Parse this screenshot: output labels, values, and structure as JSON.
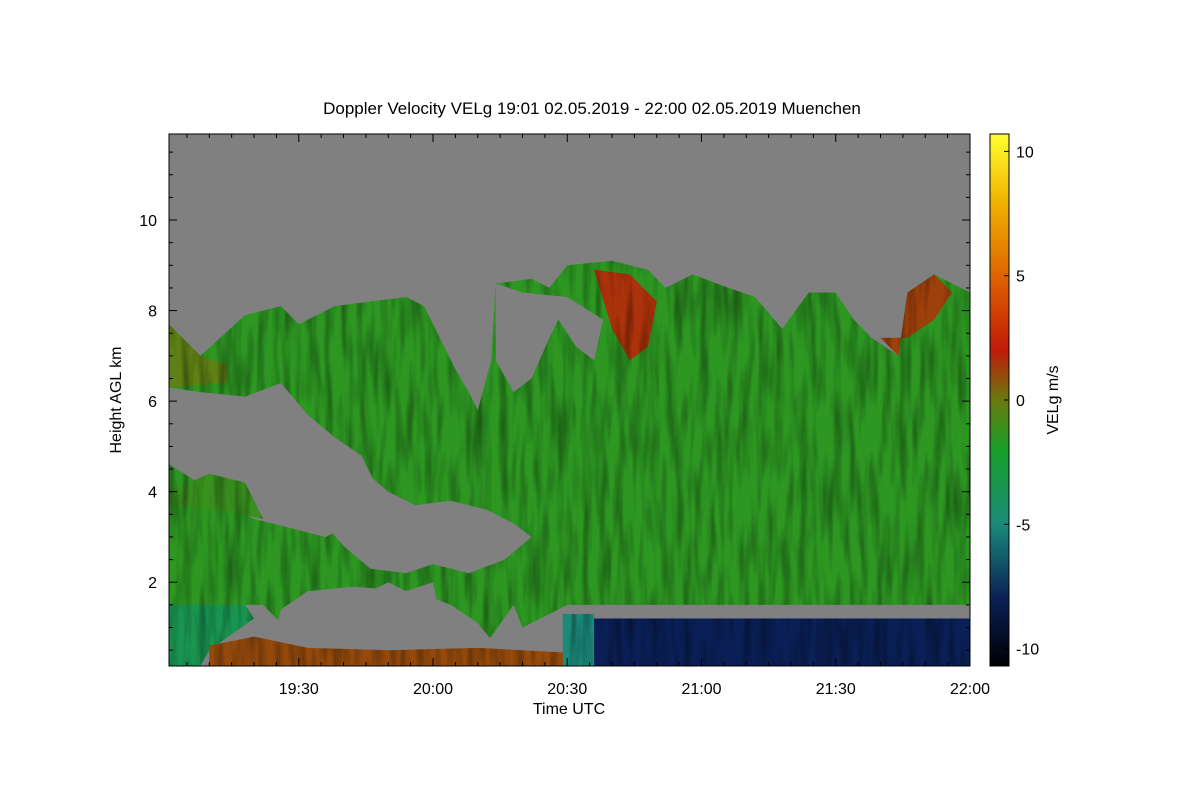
{
  "chart_data": {
    "type": "heatmap",
    "title": "Doppler Velocity VELg   19:01 02.05.2019 - 22:00 02.05.2019 Muenchen",
    "xlabel": "Time UTC",
    "ylabel": "Height AGL km",
    "colorbar_label": "VELg m/s",
    "x_range_minutes_utc": [
      1141,
      1320
    ],
    "x_ticks": [
      {
        "label": "19:30",
        "minutes": 1170
      },
      {
        "label": "20:00",
        "minutes": 1200
      },
      {
        "label": "20:30",
        "minutes": 1230
      },
      {
        "label": "21:00",
        "minutes": 1260
      },
      {
        "label": "21:30",
        "minutes": 1290
      },
      {
        "label": "22:00",
        "minutes": 1320
      }
    ],
    "ylim": [
      0.15,
      11.9
    ],
    "y_ticks": [
      2,
      4,
      6,
      8,
      10
    ],
    "colorbar": {
      "range": [
        -10.7,
        10.7
      ],
      "ticks": [
        10,
        5,
        0,
        -5,
        -10
      ],
      "stops": [
        {
          "value": -10.7,
          "color": "#000000"
        },
        {
          "value": -8.0,
          "color": "#0a1f55"
        },
        {
          "value": -5.0,
          "color": "#1a8a7a"
        },
        {
          "value": -2.0,
          "color": "#18a028"
        },
        {
          "value": 0.0,
          "color": "#6a7a10"
        },
        {
          "value": 2.0,
          "color": "#c01a08"
        },
        {
          "value": 5.0,
          "color": "#e06400"
        },
        {
          "value": 8.0,
          "color": "#f0b400"
        },
        {
          "value": 10.7,
          "color": "#ffff30"
        }
      ]
    },
    "no_signal_color": "#808080",
    "regions": [
      {
        "name": "main-cloud-green",
        "velocity": -1.5,
        "polygon": [
          [
            1141,
            7.7
          ],
          [
            1148,
            7.0
          ],
          [
            1158,
            7.9
          ],
          [
            1166,
            8.1
          ],
          [
            1170,
            7.7
          ],
          [
            1178,
            8.1
          ],
          [
            1186,
            8.2
          ],
          [
            1194,
            8.3
          ],
          [
            1198,
            8.1
          ],
          [
            1202,
            7.3
          ],
          [
            1205,
            6.7
          ],
          [
            1208,
            6.2
          ],
          [
            1210,
            5.8
          ],
          [
            1213,
            6.9
          ],
          [
            1214,
            8.6
          ],
          [
            1222,
            8.7
          ],
          [
            1226,
            8.5
          ],
          [
            1230,
            9.0
          ],
          [
            1240,
            9.1
          ],
          [
            1248,
            8.9
          ],
          [
            1252,
            8.5
          ],
          [
            1258,
            8.8
          ],
          [
            1266,
            8.5
          ],
          [
            1272,
            8.3
          ],
          [
            1278,
            7.6
          ],
          [
            1284,
            8.4
          ],
          [
            1290,
            8.4
          ],
          [
            1294,
            7.8
          ],
          [
            1298,
            7.4
          ],
          [
            1304,
            7.0
          ],
          [
            1306,
            8.4
          ],
          [
            1312,
            8.8
          ],
          [
            1320,
            8.4
          ],
          [
            1320,
            1.5
          ],
          [
            1230,
            1.5
          ],
          [
            1224,
            1.2
          ],
          [
            1220,
            1.0
          ],
          [
            1218,
            1.5
          ],
          [
            1213,
            0.8
          ],
          [
            1208,
            0.5
          ],
          [
            1202,
            1.0
          ],
          [
            1200,
            2.0
          ],
          [
            1194,
            1.8
          ],
          [
            1190,
            2.0
          ],
          [
            1184,
            1.7
          ],
          [
            1178,
            1.8
          ],
          [
            1172,
            1.2
          ],
          [
            1166,
            1.1
          ],
          [
            1162,
            1.5
          ],
          [
            1141,
            1.5
          ]
        ]
      },
      {
        "name": "gap-left-upper",
        "velocity": null,
        "polygon": [
          [
            1141,
            6.3
          ],
          [
            1148,
            6.2
          ],
          [
            1158,
            6.1
          ],
          [
            1166,
            6.4
          ],
          [
            1172,
            5.7
          ],
          [
            1178,
            5.2
          ],
          [
            1184,
            4.8
          ],
          [
            1188,
            4.0
          ],
          [
            1184,
            3.4
          ],
          [
            1176,
            3.0
          ],
          [
            1168,
            3.2
          ],
          [
            1160,
            3.4
          ],
          [
            1152,
            3.8
          ],
          [
            1146,
            4.3
          ],
          [
            1141,
            4.6
          ]
        ]
      },
      {
        "name": "gap-mid",
        "velocity": null,
        "polygon": [
          [
            1176,
            4.3
          ],
          [
            1184,
            4.5
          ],
          [
            1190,
            4.0
          ],
          [
            1196,
            3.7
          ],
          [
            1204,
            3.8
          ],
          [
            1212,
            3.6
          ],
          [
            1218,
            3.3
          ],
          [
            1222,
            3.0
          ],
          [
            1216,
            2.5
          ],
          [
            1208,
            2.2
          ],
          [
            1200,
            2.4
          ],
          [
            1194,
            2.2
          ],
          [
            1186,
            2.3
          ],
          [
            1180,
            2.8
          ],
          [
            1174,
            3.5
          ]
        ]
      },
      {
        "name": "gap-lower-left",
        "velocity": null,
        "polygon": [
          [
            1166,
            1.4
          ],
          [
            1172,
            1.8
          ],
          [
            1182,
            1.9
          ],
          [
            1196,
            1.8
          ],
          [
            1204,
            1.5
          ],
          [
            1210,
            1.1
          ],
          [
            1214,
            0.6
          ],
          [
            1220,
            0.4
          ],
          [
            1220,
            0.15
          ],
          [
            1168,
            0.15
          ],
          [
            1164,
            0.6
          ]
        ]
      },
      {
        "name": "gap-top-notch",
        "velocity": null,
        "polygon": [
          [
            1214,
            6.9
          ],
          [
            1218,
            6.2
          ],
          [
            1222,
            6.5
          ],
          [
            1226,
            7.4
          ],
          [
            1228,
            7.8
          ],
          [
            1232,
            7.2
          ],
          [
            1236,
            6.9
          ],
          [
            1238,
            7.8
          ],
          [
            1230,
            8.3
          ],
          [
            1220,
            8.4
          ],
          [
            1214,
            8.6
          ]
        ]
      },
      {
        "name": "boundary-layer-blue",
        "velocity": -8.0,
        "polygon": [
          [
            1234,
            1.2
          ],
          [
            1320,
            1.2
          ],
          [
            1320,
            0.15
          ],
          [
            1234,
            0.15
          ]
        ]
      },
      {
        "name": "boundary-layer-teal",
        "velocity": -5.0,
        "polygon": [
          [
            1229,
            1.3
          ],
          [
            1236,
            1.3
          ],
          [
            1236,
            0.15
          ],
          [
            1229,
            0.15
          ]
        ]
      },
      {
        "name": "lower-left-teal",
        "velocity": -3.5,
        "polygon": [
          [
            1141,
            1.5
          ],
          [
            1158,
            1.5
          ],
          [
            1160,
            1.2
          ],
          [
            1150,
            0.5
          ],
          [
            1148,
            0.15
          ],
          [
            1141,
            0.15
          ]
        ]
      },
      {
        "name": "surface-red-clutter",
        "velocity": 1.0,
        "polygon": [
          [
            1150,
            0.6
          ],
          [
            1160,
            0.8
          ],
          [
            1172,
            0.55
          ],
          [
            1190,
            0.5
          ],
          [
            1210,
            0.55
          ],
          [
            1229,
            0.45
          ],
          [
            1229,
            0.15
          ],
          [
            1150,
            0.15
          ]
        ]
      },
      {
        "name": "upper-red-streaks",
        "velocity": 1.5,
        "polygon": [
          [
            1236,
            8.9
          ],
          [
            1244,
            8.8
          ],
          [
            1250,
            8.2
          ],
          [
            1248,
            7.2
          ],
          [
            1244,
            6.9
          ],
          [
            1240,
            7.6
          ]
        ]
      },
      {
        "name": "upper-right-red",
        "velocity": 1.2,
        "polygon": [
          [
            1300,
            7.4
          ],
          [
            1304,
            7.0
          ],
          [
            1306,
            8.4
          ],
          [
            1312,
            8.8
          ],
          [
            1316,
            8.4
          ],
          [
            1312,
            7.8
          ],
          [
            1306,
            7.4
          ]
        ]
      },
      {
        "name": "left-olive-tip",
        "velocity": -0.3,
        "polygon": [
          [
            1141,
            7.7
          ],
          [
            1148,
            7.0
          ],
          [
            1154,
            6.8
          ],
          [
            1154,
            6.4
          ],
          [
            1141,
            6.3
          ]
        ]
      },
      {
        "name": "left-green-bands",
        "velocity": -1.2,
        "polygon": [
          [
            1141,
            4.0
          ],
          [
            1150,
            4.4
          ],
          [
            1158,
            4.2
          ],
          [
            1162,
            3.4
          ],
          [
            1152,
            3.6
          ],
          [
            1141,
            3.7
          ]
        ]
      }
    ]
  }
}
